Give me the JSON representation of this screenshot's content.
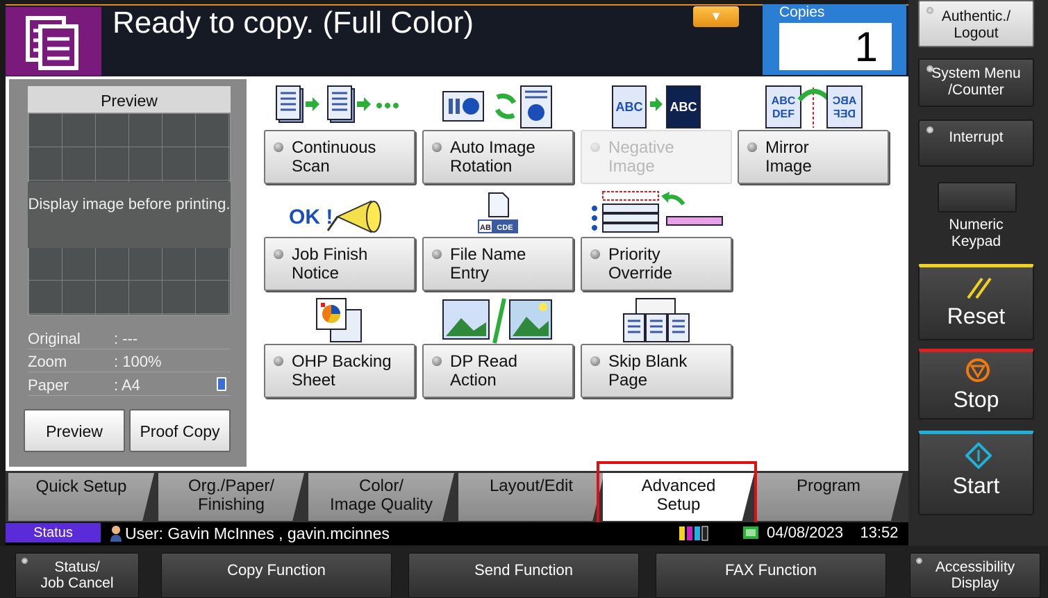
{
  "header": {
    "title": "Ready to copy. (Full Color)",
    "dropdown_arrow": "▼",
    "copies_label": "Copies",
    "copies_value": "1"
  },
  "preview_panel": {
    "heading": "Preview",
    "placeholder": "Display image before printing.",
    "original_label": "Original",
    "original_value": ": ---",
    "zoom_label": "Zoom",
    "zoom_value": ": 100%",
    "paper_label": "Paper",
    "paper_value": ": A4",
    "preview_button": "Preview",
    "proof_copy_button": "Proof Copy"
  },
  "functions": [
    {
      "label": "Continuous\nScan",
      "icon": "continuous-scan-icon",
      "enabled": true
    },
    {
      "label": "Auto Image\nRotation",
      "icon": "rotation-icon",
      "enabled": true
    },
    {
      "label": "Negative\nImage",
      "icon": "negative-image-icon",
      "enabled": false
    },
    {
      "label": "Mirror\nImage",
      "icon": "mirror-image-icon",
      "enabled": true
    },
    {
      "label": "Job Finish\nNotice",
      "icon": "megaphone-icon",
      "enabled": true
    },
    {
      "label": "File Name\nEntry",
      "icon": "file-name-icon",
      "enabled": true
    },
    {
      "label": "Priority\nOverride",
      "icon": "priority-icon",
      "enabled": true
    },
    {
      "label": "OHP Backing\nSheet",
      "icon": "ohp-icon",
      "enabled": true
    },
    {
      "label": "DP Read\nAction",
      "icon": "dp-read-icon",
      "enabled": true
    },
    {
      "label": "Skip Blank\nPage",
      "icon": "skip-blank-icon",
      "enabled": true
    }
  ],
  "icon_text": {
    "abc": "ABC",
    "abc_def": "ABC\nDEF",
    "abc_def_mirror": "ABC\nDEF",
    "ok": "OK !",
    "file_name": "AB CDE"
  },
  "tabs": [
    {
      "label": "Quick Setup",
      "active": false
    },
    {
      "label": "Org./Paper/\nFinishing",
      "active": false
    },
    {
      "label": "Color/\nImage Quality",
      "active": false
    },
    {
      "label": "Layout/Edit",
      "active": false
    },
    {
      "label": "Advanced\nSetup",
      "active": true
    },
    {
      "label": "Program",
      "active": false
    }
  ],
  "status_bar": {
    "status_label": "Status",
    "user": "User: Gavin McInnes , gavin.mcinnes",
    "date": "04/08/2023",
    "time": "13:52"
  },
  "side_panel": {
    "authentic": "Authentic./\nLogout",
    "system_menu": "System Menu\n/Counter",
    "interrupt": "Interrupt",
    "numeric_keypad": "Numeric\nKeypad",
    "reset": "Reset",
    "stop": "Stop",
    "start": "Start"
  },
  "bottom_bar": {
    "status_job_cancel": "Status/\nJob Cancel",
    "copy_function": "Copy Function",
    "send_function": "Send Function",
    "fax_function": "FAX Function",
    "accessibility_display": "Accessibility\nDisplay"
  },
  "colors": {
    "header_bg": "#161a24",
    "header_icon_bg": "#7a1a7c",
    "copies_blue": "#2a7fd4",
    "highlight_red": "#e01010",
    "reset_yellow": "#f0d020",
    "stop_red": "#e02020",
    "stop_orange": "#f07a10",
    "start_cyan": "#20b0d8",
    "status_purple": "#5a2bd8"
  }
}
